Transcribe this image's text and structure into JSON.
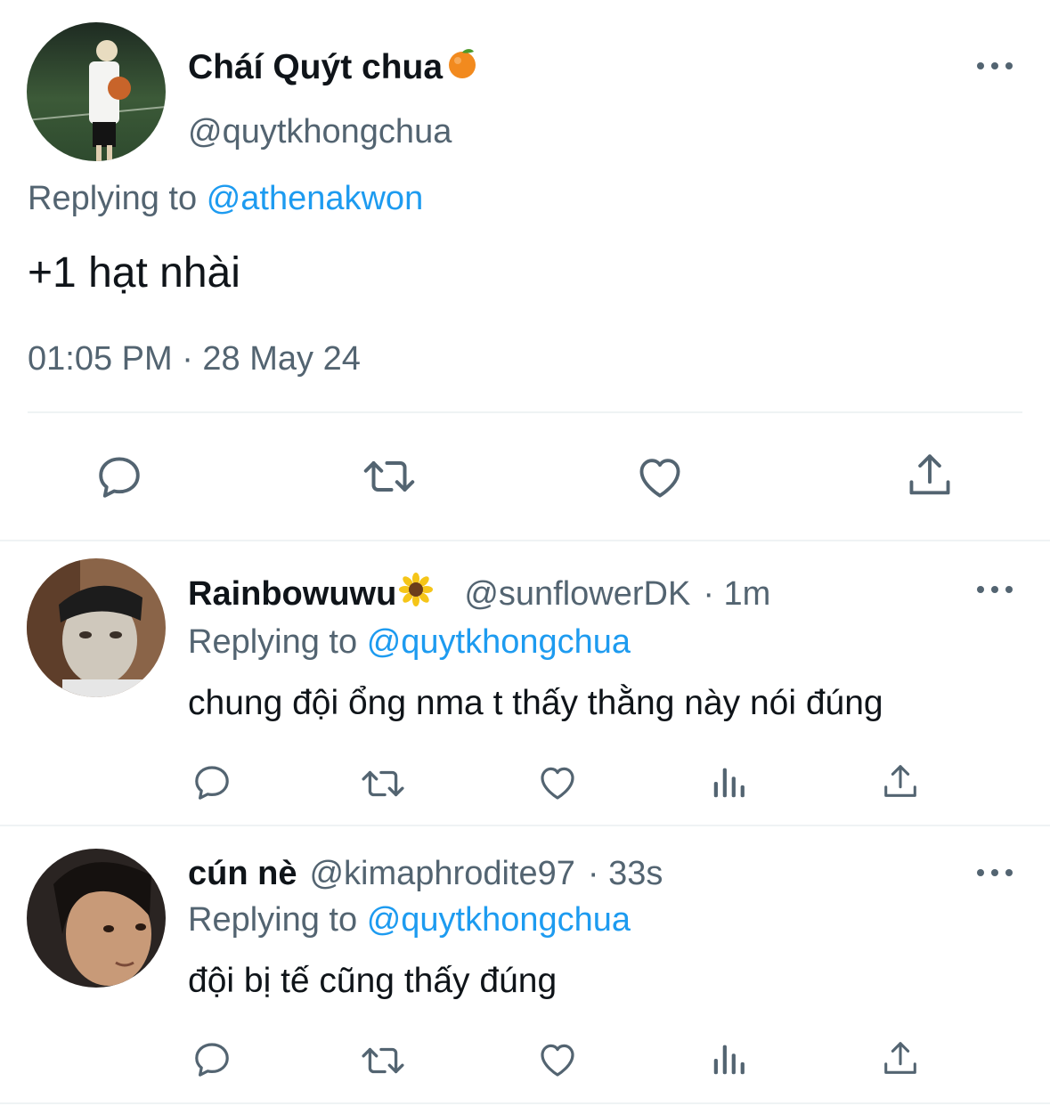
{
  "main_tweet": {
    "display_name": "Cháí Quýt chua",
    "handle": "@quytkhongchua",
    "replying_prefix": "Replying to",
    "replying_to": "@athenakwon",
    "text": "+1 hạt nhài",
    "timestamp": "01:05 PM · 28 May 24",
    "name_emoji": "orange-icon"
  },
  "replies": [
    {
      "display_name": "Rainbowuwu",
      "name_emoji": "sunflower-icon",
      "handle": "@sunflowerDK",
      "age": "· 1m",
      "replying_prefix": "Replying to",
      "replying_to": "@quytkhongchua",
      "text": "chung đội ổng nma t thấy thằng này nói đúng"
    },
    {
      "display_name": "cún nè",
      "handle": "@kimaphrodite97",
      "age": "· 33s",
      "replying_prefix": "Replying to",
      "replying_to": "@quytkhongchua",
      "text": "đội bị tế cũng thấy đúng"
    }
  ],
  "colors": {
    "text": "#0f1419",
    "muted": "#536471",
    "accent": "#1d9bf0",
    "divider": "#eff3f4"
  }
}
